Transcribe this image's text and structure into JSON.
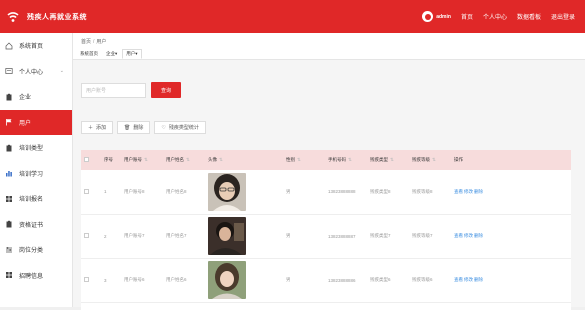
{
  "header": {
    "title": "残疾人再就业系统",
    "admin": "admin",
    "nav": [
      "首页",
      "个人中心",
      "数据看板",
      "退出登录"
    ]
  },
  "sidebar": {
    "items": [
      {
        "label": "系统首页",
        "icon": "home-icon"
      },
      {
        "label": "个人中心",
        "icon": "user-icon",
        "expandable": true
      },
      {
        "label": "企业",
        "icon": "clipboard-icon"
      },
      {
        "label": "用户",
        "icon": "flag-icon",
        "active": true
      },
      {
        "label": "培训类型",
        "icon": "clipboard-icon"
      },
      {
        "label": "培训学习",
        "icon": "bar-chart-icon"
      },
      {
        "label": "培训报名",
        "icon": "grid-icon"
      },
      {
        "label": "资格证书",
        "icon": "clipboard-icon"
      },
      {
        "label": "岗位分类",
        "icon": "sliders-icon"
      },
      {
        "label": "招聘信息",
        "icon": "grid-icon"
      }
    ]
  },
  "breadcrumb": {
    "home": "首页",
    "current": "用户"
  },
  "tabs": [
    "系统首页",
    "企业",
    "用户"
  ],
  "search": {
    "placeholder": "用户账号",
    "button": "查询"
  },
  "actions": {
    "add": "添加",
    "delete": "删除",
    "stats": "残疾类型统计"
  },
  "table": {
    "headers": [
      "序号",
      "用户账号",
      "用户姓名",
      "头像",
      "性别",
      "手机号码",
      "残疾类型",
      "残疾等级",
      "操作"
    ],
    "rows": [
      {
        "index": "1",
        "account": "用户账号8",
        "name": "用户姓名8",
        "gender": "男",
        "phone": "13823888888",
        "disability_type": "残疾类型8",
        "disability_level": "残疾等级8"
      },
      {
        "index": "2",
        "account": "用户账号7",
        "name": "用户姓名7",
        "gender": "男",
        "phone": "13823888887",
        "disability_type": "残疾类型7",
        "disability_level": "残疾等级7"
      },
      {
        "index": "3",
        "account": "用户账号6",
        "name": "用户姓名6",
        "gender": "男",
        "phone": "13823888886",
        "disability_type": "残疾类型6",
        "disability_level": "残疾等级6"
      }
    ],
    "ops": [
      "查看",
      "修改",
      "删除"
    ]
  },
  "colors": {
    "brand": "#e02828",
    "header_row": "#f7dcdc",
    "link": "#3a8de0"
  }
}
